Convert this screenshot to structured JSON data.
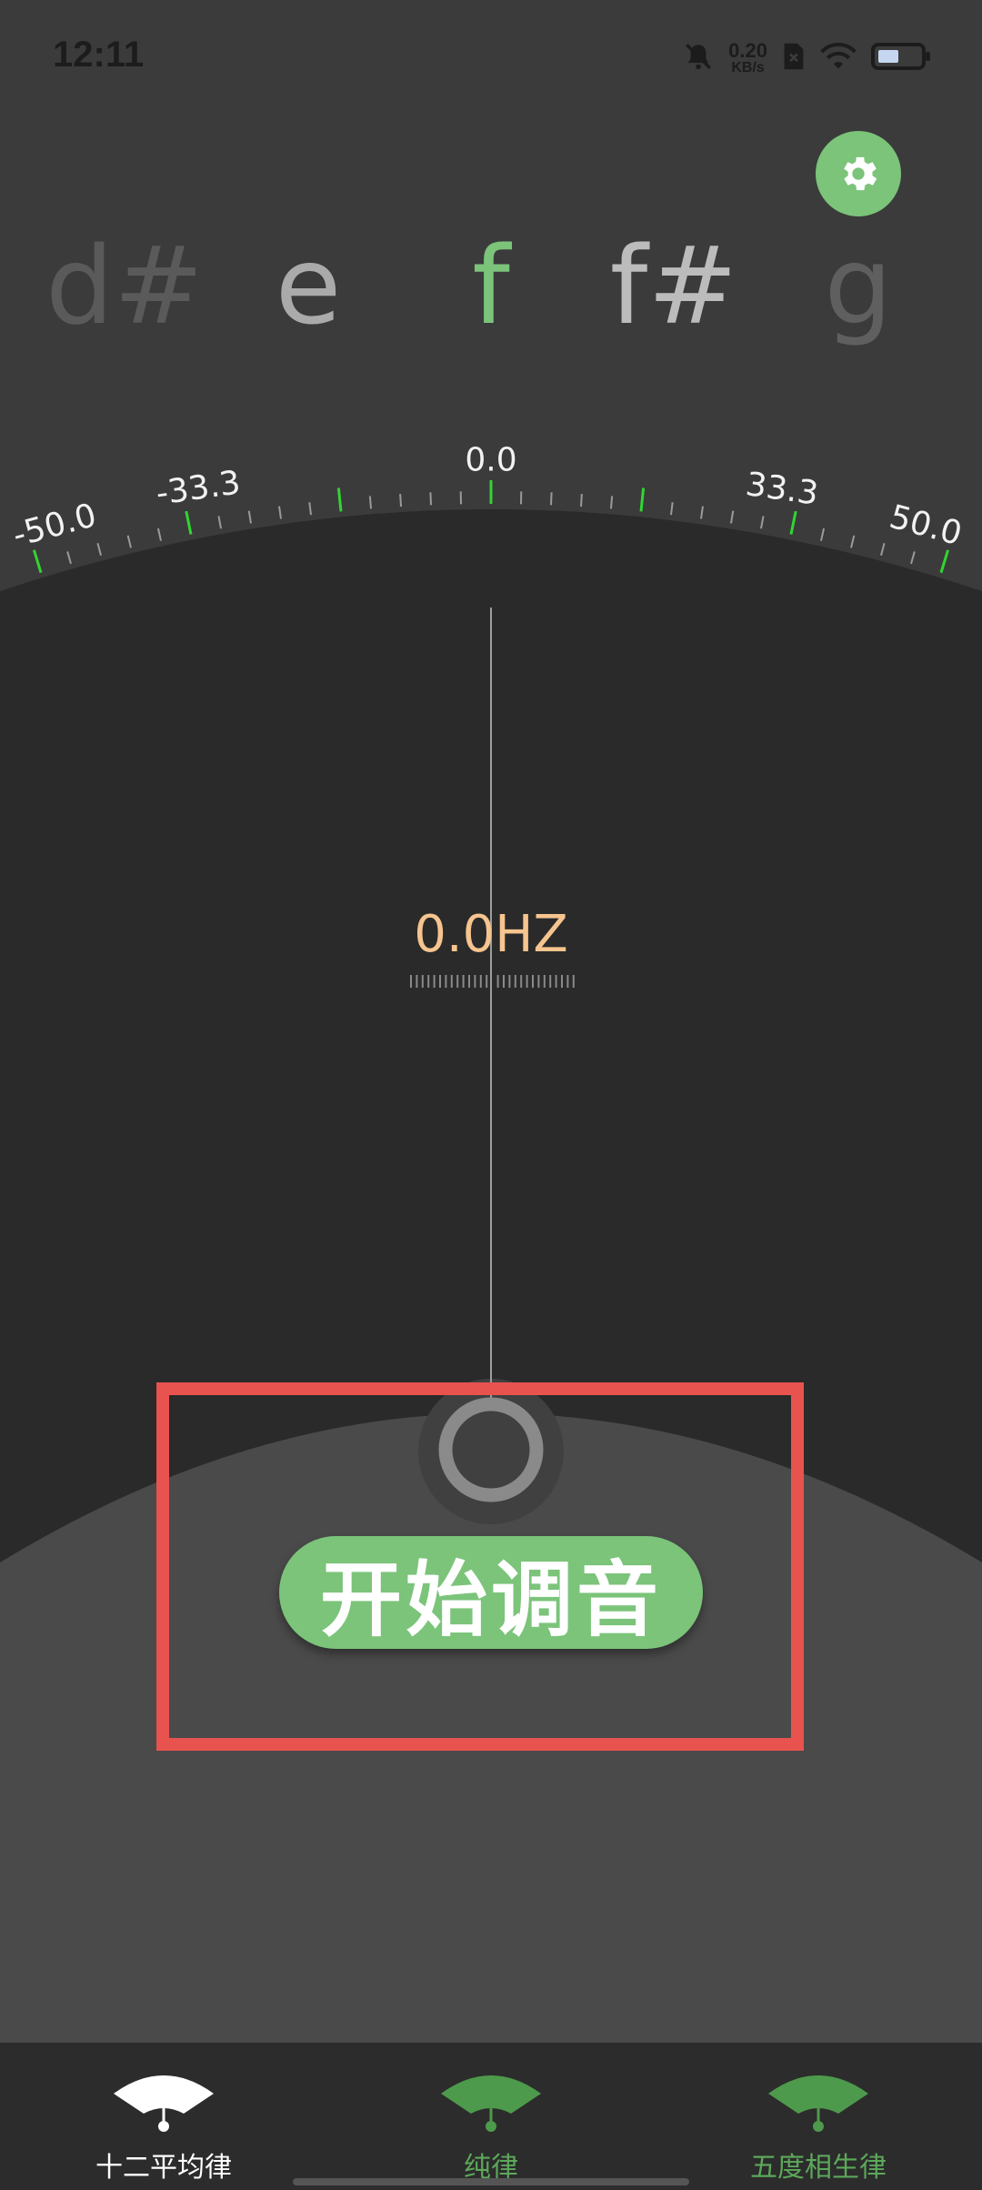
{
  "status_bar": {
    "time": "12:11",
    "net_speed_value": "0.20",
    "net_speed_unit": "KB/s"
  },
  "notes": [
    {
      "label": "d#",
      "color": "#5a5a5a"
    },
    {
      "label": "e",
      "color": "#aaaaaa"
    },
    {
      "label": "f",
      "color": "#7bc47a"
    },
    {
      "label": "f#",
      "color": "#bcbcbc"
    },
    {
      "label": "g",
      "color": "#5f5f5f"
    }
  ],
  "gauge": {
    "labels": [
      "-50.0",
      "-33.3",
      "0.0",
      "33.3",
      "50.0"
    ]
  },
  "frequency": "0.0HZ",
  "start_button": "开始调音",
  "nav": [
    {
      "label": "十二平均律",
      "active": true
    },
    {
      "label": "纯律",
      "active": false
    },
    {
      "label": "五度相生律",
      "active": false
    }
  ],
  "colors": {
    "accent": "#7bc47a",
    "highlight": "#e8534f",
    "frequency": "#f6c48e",
    "tick_major": "#32d432"
  }
}
